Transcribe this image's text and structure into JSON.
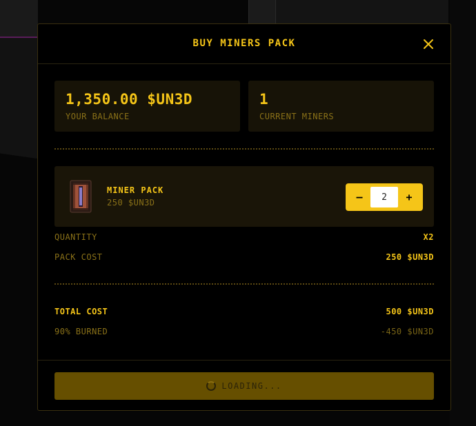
{
  "modal": {
    "title": "BUY MINERS PACK"
  },
  "stats": {
    "balance_value": "1,350.00 $UN3D",
    "balance_label": "YOUR BALANCE",
    "miners_value": "1",
    "miners_label": "CURRENT MINERS"
  },
  "pack": {
    "name": "MINER PACK",
    "price": "250 $UN3D",
    "quantity": "2",
    "minus_label": "–",
    "plus_label": "+"
  },
  "summary": {
    "quantity_label": "QUANTITY",
    "quantity_value": "X2",
    "pack_cost_label": "PACK COST",
    "pack_cost_value": "250 $UN3D",
    "total_cost_label": "TOTAL COST",
    "total_cost_value": "500 $UN3D",
    "burned_label": "90% BURNED",
    "burned_value": "-450 $UN3D"
  },
  "footer": {
    "button_label": "LOADING..."
  },
  "icons": {
    "close": "close-icon",
    "spinner": "spinner-icon",
    "pack": "miner-pack-image"
  },
  "colors": {
    "accent": "#f5c518",
    "muted": "#8a7118",
    "card_bg": "#171307",
    "button_disabled": "#664f00"
  }
}
